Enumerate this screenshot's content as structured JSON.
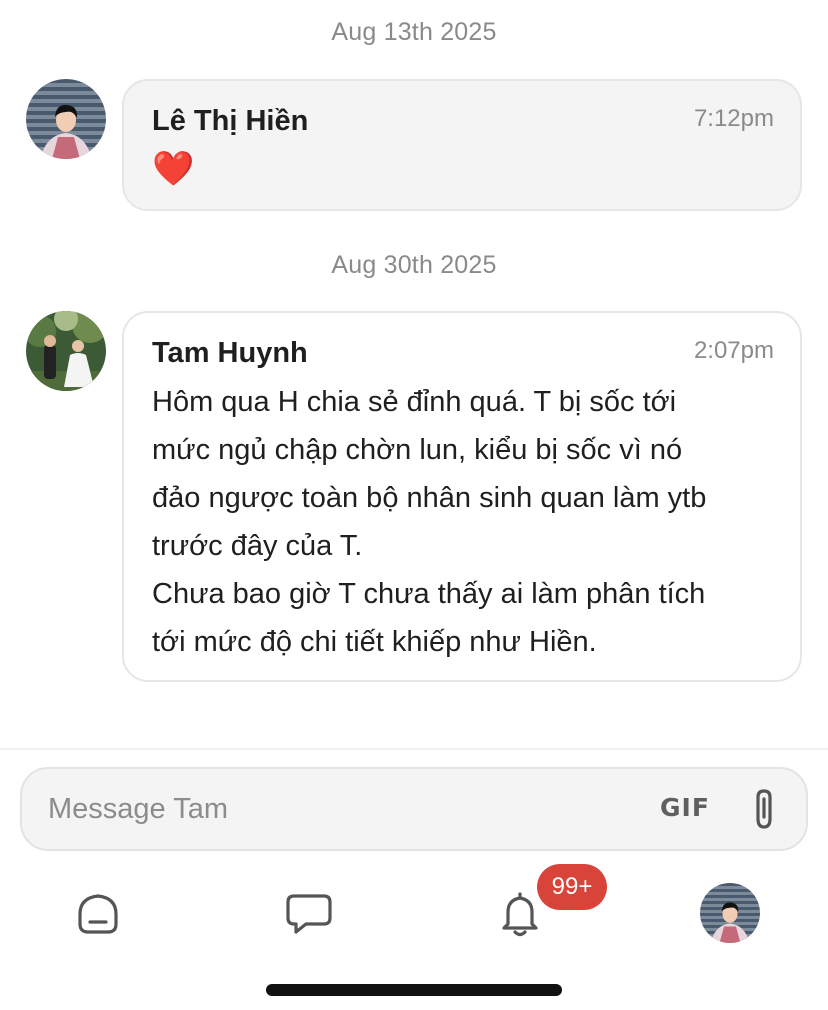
{
  "messages": [
    {
      "date": "Aug 13th 2025",
      "sender": "Lê Thị Hiền",
      "time": "7:12pm",
      "text": "❤️"
    },
    {
      "date": "Aug 30th 2025",
      "sender": "Tam Huynh",
      "time": "2:07pm",
      "lines": [
        "Hôm qua H chia sẻ đỉnh quá. T bị sốc tới",
        "mức ngủ chập chờn lun, kiểu bị sốc vì nó",
        "đảo ngược toàn bộ nhân sinh quan làm ytb",
        "trước đây của T.",
        "Chưa bao giờ T chưa thấy ai làm phân tích",
        "tới mức độ chi tiết khiếp như Hiền."
      ]
    }
  ],
  "composer": {
    "placeholder": "Message Tam",
    "gif_label": "GIF",
    "attach_icon": "paperclip-icon"
  },
  "bottom_nav": {
    "items": [
      {
        "icon": "home-icon"
      },
      {
        "icon": "chat-bubble-icon"
      },
      {
        "icon": "bell-icon"
      },
      {
        "icon": "profile-avatar"
      }
    ],
    "notification_badge": "99+"
  },
  "colors": {
    "badge": "#d9443a",
    "bubble_border": "#e6e6e6",
    "muted_text": "#8a8a8a"
  }
}
